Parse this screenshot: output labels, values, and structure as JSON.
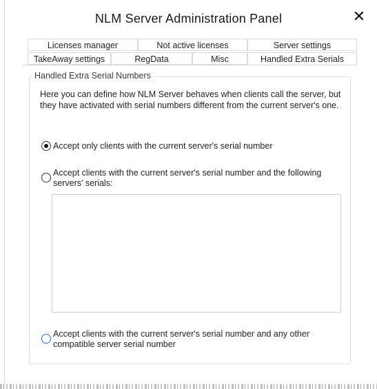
{
  "window": {
    "title": "NLM Server Administration Panel",
    "close_label": "✕"
  },
  "tabs": {
    "row1": [
      "Licenses manager",
      "Not active licenses",
      "Server settings"
    ],
    "row2": [
      "TakeAway settings",
      "RegData",
      "Misc",
      "Handled Extra Serials"
    ],
    "active": "Handled Extra Serials"
  },
  "group": {
    "label": "Handled Extra Serial Numbers",
    "description": "Here you can define how NLM Server behaves when clients call the server, but they have activated with serial numbers different from the current server's one.",
    "options": [
      {
        "label": "Accept only clients with the current server's serial number",
        "selected": true
      },
      {
        "label": "Accept clients with the current server's serial number and the following servers' serials:",
        "selected": false
      },
      {
        "label": "Accept clients with the current server's serial number and any other compatible server serial number",
        "selected": false
      }
    ],
    "serials_list": []
  },
  "colors": {
    "border": "#d9d9d9",
    "focus_radio": "#2b6fd6",
    "text": "#222222"
  }
}
